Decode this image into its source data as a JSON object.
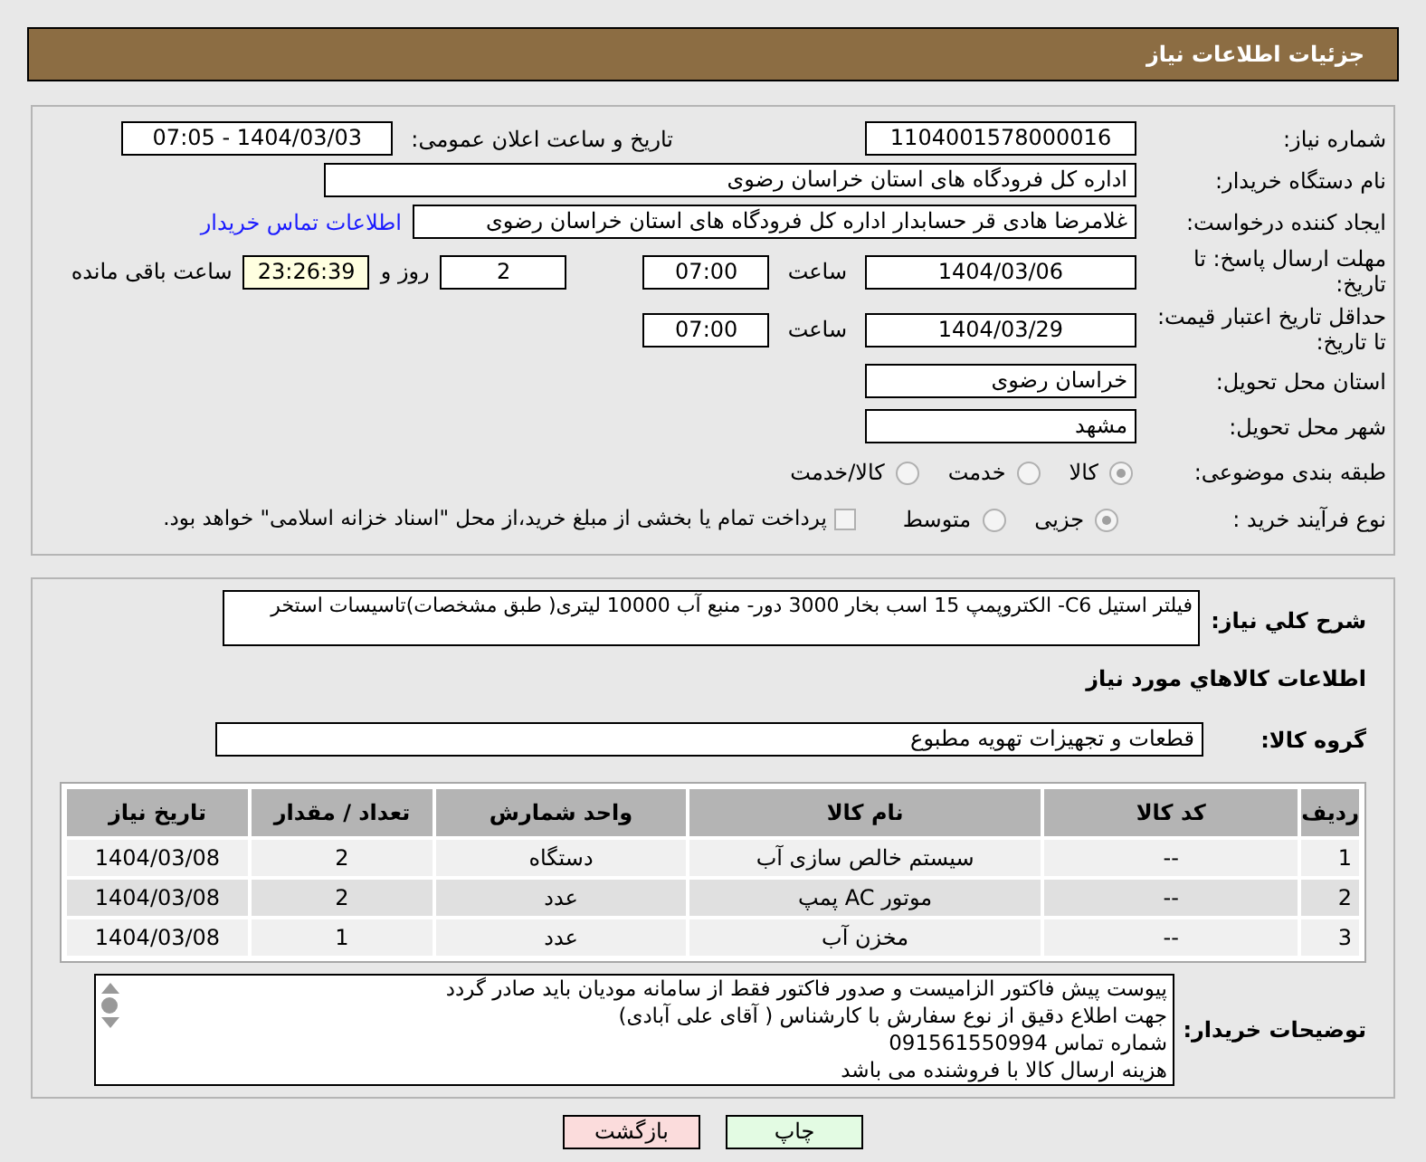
{
  "header": {
    "title": "جزئیات اطلاعات نیاز"
  },
  "need_number": {
    "label": "شماره نیاز:",
    "value": "1104001578000016"
  },
  "announce": {
    "label": "تاریخ و ساعت اعلان عمومی:",
    "value": "1404/03/03 - 07:05"
  },
  "buyer_org": {
    "label": "نام دستگاه خریدار:",
    "value": "اداره کل فرودگاه های استان خراسان رضوی"
  },
  "requester": {
    "label": "ایجاد کننده درخواست:",
    "value": "غلامرضا هادی قر حسابدار اداره کل فرودگاه های استان خراسان رضوی",
    "link": "اطلاعات تماس خریدار"
  },
  "reply_deadline": {
    "label": "مهلت ارسال پاسخ: تا تاریخ:",
    "date": "1404/03/06",
    "time_label": "ساعت",
    "time": "07:00",
    "days": "2",
    "days_label": "روز و",
    "remaining": "23:26:39",
    "remaining_label": "ساعت باقی مانده"
  },
  "price_validity": {
    "label": "حداقل تاریخ اعتبار قیمت: تا تاریخ:",
    "date": "1404/03/29",
    "time_label": "ساعت",
    "time": "07:00"
  },
  "province": {
    "label": "استان محل تحویل:",
    "value": "خراسان رضوی"
  },
  "city": {
    "label": "شهر محل تحویل:",
    "value": "مشهد"
  },
  "category": {
    "label": "طبقه بندی موضوعی:",
    "options": [
      {
        "label": "کالا",
        "selected": true
      },
      {
        "label": "خدمت",
        "selected": false
      },
      {
        "label": "کالا/خدمت",
        "selected": false
      }
    ]
  },
  "process": {
    "label": "نوع فرآیند خرید :",
    "options": [
      {
        "label": "جزیی",
        "selected": true
      },
      {
        "label": "متوسط",
        "selected": false
      }
    ],
    "treasury": {
      "label": "پرداخت تمام یا بخشی از مبلغ خرید،از محل \"اسناد خزانه اسلامی\" خواهد بود.",
      "checked": false
    }
  },
  "summary": {
    "label": "شرح کلي نياز:",
    "value": "فیلتر استیل C6-  الکتروپمپ 15 اسب بخار 3000 دور- منبع آب 10000 لیتری( طبق مشخصات)تاسیسات استخر"
  },
  "goods_heading": "اطلاعات کالاهاي مورد نياز",
  "goods_group": {
    "label": "گروه کالا:",
    "value": "قطعات و تجهیزات تهویه مطبوع"
  },
  "table": {
    "columns": [
      "ردیف",
      "کد کالا",
      "نام کالا",
      "واحد شمارش",
      "تعداد / مقدار",
      "تاریخ نیاز"
    ],
    "rows": [
      [
        "1",
        "--",
        "سیستم خالص سازی آب",
        "دستگاه",
        "2",
        "1404/03/08"
      ],
      [
        "2",
        "--",
        "موتور AC پمپ",
        "عدد",
        "2",
        "1404/03/08"
      ],
      [
        "3",
        "--",
        "مخزن آب",
        "عدد",
        "1",
        "1404/03/08"
      ]
    ]
  },
  "buyer_notes": {
    "label": "توضیحات خریدار:",
    "lines": [
      "پیوست پیش فاکتور الزامیست و صدور فاکتور فقط از سامانه مودیان باید صادر گردد",
      "جهت اطلاع دقیق از نوع سفارش با کارشناس  ( آقای علی آبادی)",
      "شماره تماس 091561550994",
      "هزینه ارسال کالا با فروشنده می باشد"
    ]
  },
  "buttons": [
    {
      "label": "چاپ",
      "kind": "print"
    },
    {
      "label": "بازگشت",
      "kind": "back"
    }
  ]
}
